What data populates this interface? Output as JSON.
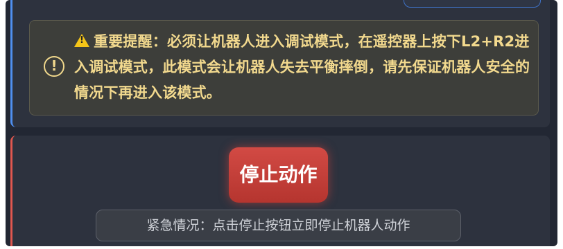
{
  "warning_panel": {
    "icon": "exclamation-circle-icon",
    "icon_glyph": "!",
    "emoji_icon": "warning-triangle-icon",
    "text": "重要提醒：必须让机器人进入调试模式，在遥控器上按下L2+R2进入调试模式，此模式会让机器人失去平衡摔倒，请先保证机器人安全的情况下再进入该模式。",
    "accent_color": "#4f8ff0",
    "text_color": "#f2d98e"
  },
  "stop_panel": {
    "stop_button_label": "停止动作",
    "emergency_note": "紧急情况：点击停止按钮立即停止机器人动作",
    "accent_color": "#e0574f",
    "button_color": "#c8403a"
  }
}
